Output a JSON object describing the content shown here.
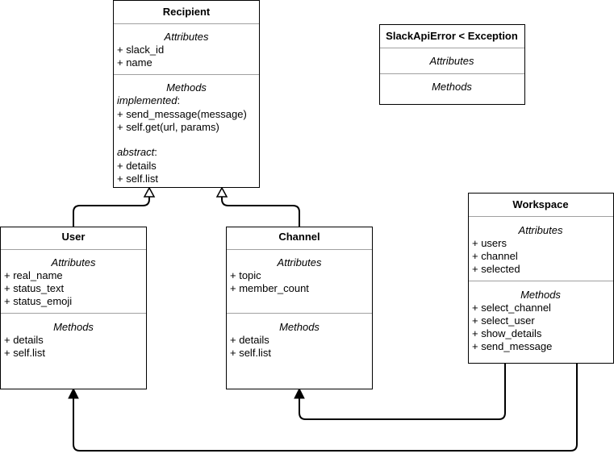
{
  "classes": {
    "recipient": {
      "name": "Recipient",
      "attributes_label": "Attributes",
      "attributes": [
        "+ slack_id",
        "+ name"
      ],
      "methods_label": "Methods",
      "implemented_label": "implemented",
      "implemented": [
        "+ send_message(message)",
        "+ self.get(url, params)"
      ],
      "abstract_label": "abstract",
      "abstract": [
        "+ details",
        "+ self.list"
      ]
    },
    "slack_api_error": {
      "name": "SlackApiError < Exception",
      "attributes_label": "Attributes",
      "methods_label": "Methods"
    },
    "user": {
      "name": "User",
      "attributes_label": "Attributes",
      "attributes": [
        "+ real_name",
        "+ status_text",
        "+ status_emoji"
      ],
      "methods_label": "Methods",
      "methods": [
        "+ details",
        "+ self.list"
      ]
    },
    "channel": {
      "name": "Channel",
      "attributes_label": "Attributes",
      "attributes": [
        "+ topic",
        "+ member_count"
      ],
      "methods_label": "Methods",
      "methods": [
        "+ details",
        "+ self.list"
      ]
    },
    "workspace": {
      "name": "Workspace",
      "attributes_label": "Attributes",
      "attributes": [
        "+ users",
        "+ channel",
        "+ selected"
      ],
      "methods_label": "Methods",
      "methods": [
        "+ select_channel",
        "+ select_user",
        "+ show_details",
        "+ send_message"
      ]
    }
  },
  "relations": [
    {
      "from": "User",
      "to": "Recipient",
      "type": "inheritance"
    },
    {
      "from": "Channel",
      "to": "Recipient",
      "type": "inheritance"
    },
    {
      "from": "Workspace",
      "to": "Channel",
      "type": "association"
    },
    {
      "from": "Workspace",
      "to": "User",
      "type": "association"
    }
  ]
}
